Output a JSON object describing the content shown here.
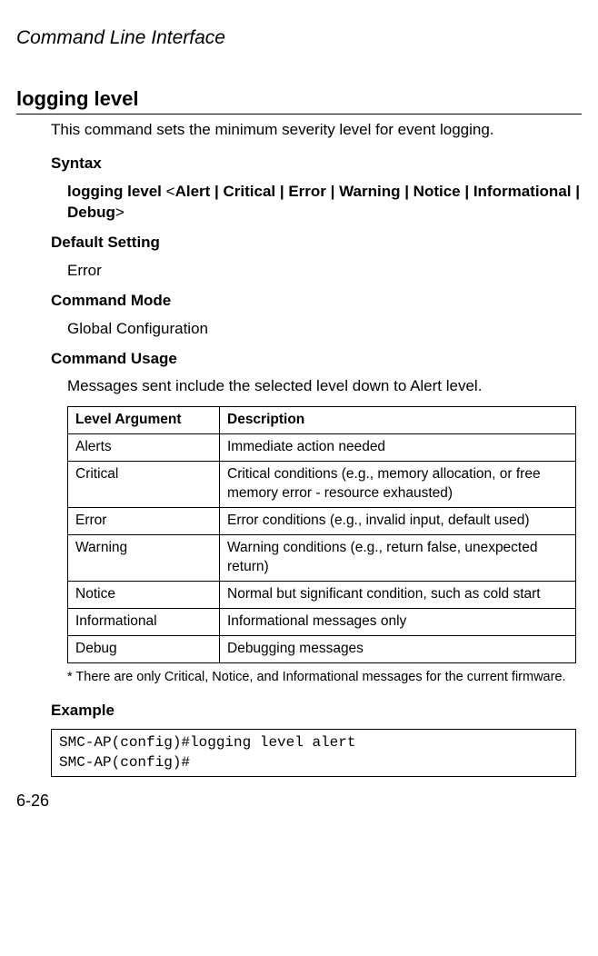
{
  "chapter": "Command Line Interface",
  "section_title": "logging level",
  "description": "This command sets the minimum severity level for event logging.",
  "syntax_heading": "Syntax",
  "syntax_text": "logging level <Alert | Critical | Error | Warning | Notice | Informational | Debug>",
  "default_setting_heading": "Default Setting",
  "default_setting_value": "Error",
  "command_mode_heading": "Command Mode",
  "command_mode_value": "Global Configuration",
  "command_usage_heading": "Command Usage",
  "command_usage_text": "Messages sent include the selected level down to Alert level.",
  "table": {
    "headers": {
      "arg": "Level Argument",
      "desc": "Description"
    },
    "rows": [
      {
        "arg": "Alerts",
        "desc": "Immediate action needed"
      },
      {
        "arg": "Critical",
        "desc": "Critical conditions (e.g., memory allocation, or free memory error - resource exhausted)"
      },
      {
        "arg": "Error",
        "desc": "Error conditions (e.g., invalid input, default used)"
      },
      {
        "arg": "Warning",
        "desc": "Warning conditions (e.g., return false, unexpected return)"
      },
      {
        "arg": "Notice",
        "desc": "Normal but significant condition, such as cold start"
      },
      {
        "arg": "Informational",
        "desc": "Informational messages only"
      },
      {
        "arg": "Debug",
        "desc": "Debugging messages"
      }
    ]
  },
  "footnote": "* There are only Critical, Notice, and Informational messages for the current firmware.",
  "example_heading": "Example",
  "example_code": "SMC-AP(config)#logging level alert\nSMC-AP(config)#",
  "page_number": "6-26"
}
